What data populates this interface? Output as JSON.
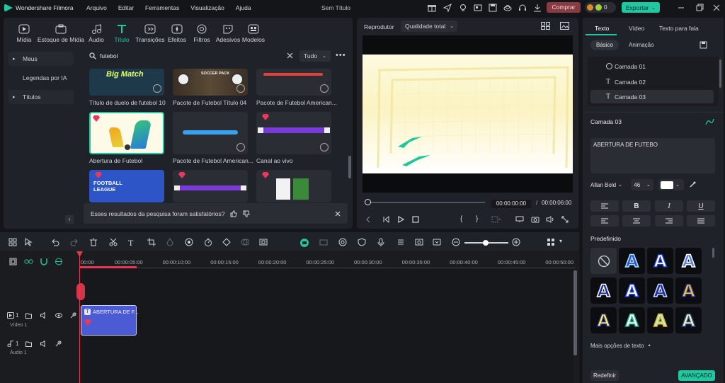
{
  "app": {
    "title": "Wondershare Filmora",
    "menu": [
      "Arquivo",
      "Editar",
      "Ferramentas",
      "Visualização",
      "Ajuda"
    ],
    "project_title": "Sem Título",
    "buy_label": "Comprar",
    "credits": "0",
    "export_label": "Exportar"
  },
  "media_tabs": [
    {
      "label": "Mídia",
      "icon": "media-icon"
    },
    {
      "label": "Estoque de Mídia",
      "icon": "stock-media-icon"
    },
    {
      "label": "Áudio",
      "icon": "audio-icon"
    },
    {
      "label": "Título",
      "icon": "title-icon"
    },
    {
      "label": "Transições",
      "icon": "transitions-icon"
    },
    {
      "label": "Efeitos",
      "icon": "effects-icon"
    },
    {
      "label": "Filtros",
      "icon": "filters-icon"
    },
    {
      "label": "Adesivos",
      "icon": "stickers-icon"
    },
    {
      "label": "Modelos",
      "icon": "templates-icon"
    }
  ],
  "sidebar": {
    "items": [
      "Meus",
      "Legendas por IA",
      "Títulos"
    ]
  },
  "search": {
    "value": "futebol",
    "filter": "Tudo"
  },
  "thumbs": [
    {
      "caption": "Título de duelo de futebol 10",
      "art": "Big Match"
    },
    {
      "caption": "Pacote de Futebol Título 04",
      "art": "SOCCER PACK"
    },
    {
      "caption": "Pacote de Futebol American...",
      "art": ""
    },
    {
      "caption": "Abertura de Futebol",
      "art": ""
    },
    {
      "caption": "Pacote de Futebol American...",
      "art": ""
    },
    {
      "caption": "Canal ao vivo",
      "art": ""
    },
    {
      "caption": "",
      "art": "FOOTBALL LEAGUE"
    },
    {
      "caption": "",
      "art": ""
    },
    {
      "caption": "",
      "art": ""
    }
  ],
  "feedback": {
    "text": "Esses resultados da pesquisa foram satisfatórios?"
  },
  "player": {
    "label": "Reprodutor",
    "quality": "Qualidade total",
    "current_time": "00:00:00:00",
    "separator": "/",
    "total_time": "00:00:06:00"
  },
  "right_panel": {
    "tabs": [
      "Texto",
      "Vídeo",
      "Texto para fala"
    ],
    "subtabs": [
      "Básico",
      "Animação"
    ],
    "layers": [
      "Camada 01",
      "Camada 02",
      "Camada 03"
    ],
    "section_title": "Camada 03",
    "text_value": "ABERTURA DE FUTEBO",
    "font": "Allan Bold",
    "size": "46",
    "preset_label": "Predefinido",
    "more_label": "Mais opções de texto",
    "reset_label": "Redefinir",
    "advanced_label": "AVANÇADO",
    "fmt_buttons": [
      "B",
      "I",
      "U"
    ],
    "presets": [
      {
        "style": "none"
      },
      {
        "letter": "A",
        "fill": "#3a4fd8",
        "stroke": "#9fe6ff"
      },
      {
        "letter": "A",
        "fill": "#ffffff",
        "stroke": "#1b3bd0"
      },
      {
        "letter": "A",
        "fill": "#5a7df0",
        "stroke": "#ffffff"
      },
      {
        "letter": "A",
        "fill": "#1c2fa8",
        "stroke": "#ffffff"
      },
      {
        "letter": "A",
        "fill": "#ffffff",
        "stroke": "#2747e6"
      },
      {
        "letter": "A",
        "fill": "#1a2ea0",
        "stroke": "#c9d7ff"
      },
      {
        "letter": "A",
        "fill": "#f3c02a",
        "stroke": "#1a2ea0"
      },
      {
        "letter": "A",
        "fill": "#ffe66b",
        "stroke": "#1d2a7a"
      },
      {
        "letter": "A",
        "fill": "#ffffff",
        "stroke": "#19b08a"
      },
      {
        "letter": "A",
        "fill": "#b7f0d0",
        "stroke": "#e8b21e"
      },
      {
        "letter": "A",
        "fill": "#fff3a0",
        "stroke": "#1f4aa0"
      }
    ]
  },
  "timeline": {
    "ruler": [
      "00:00",
      "00:00:05:00",
      "00:00:10:00",
      "00:00:15:00",
      "00:00:20:00",
      "00:00:25:00",
      "00:00:30:00",
      "00:00:35:00",
      "00:00:40:00",
      "00:00:45:00",
      "00:00:50:00"
    ],
    "video_track": {
      "number": "1",
      "name": "Vídeo 1"
    },
    "audio_track": {
      "number": "1",
      "name": "Áudio 1"
    },
    "clip_label": "ABERTURA DE F..."
  },
  "colors": {
    "accent": "#1ec8a0",
    "buy": "#8a3b42",
    "export": "#1ec8a0",
    "clip": "#4a5bd4",
    "playhead": "#e8384f"
  }
}
